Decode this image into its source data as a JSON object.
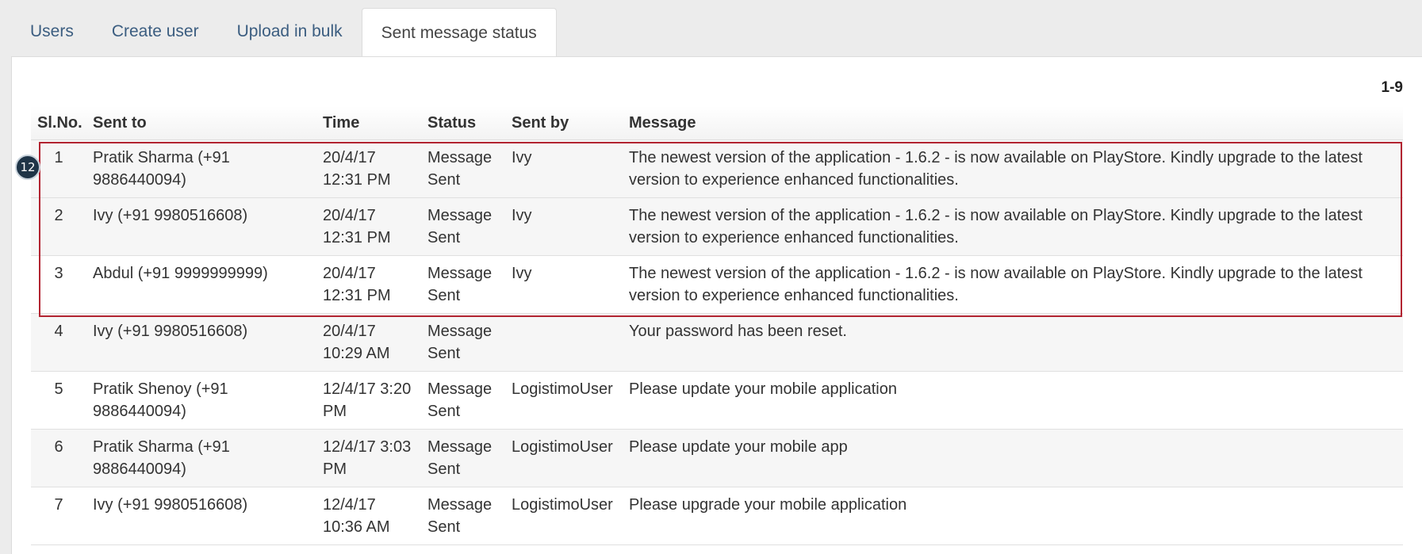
{
  "tabs": [
    {
      "label": "Users"
    },
    {
      "label": "Create user"
    },
    {
      "label": "Upload in bulk"
    },
    {
      "label": "Sent message status",
      "active": true
    }
  ],
  "pagination": {
    "range": "1-9"
  },
  "table": {
    "headers": [
      "Sl.No.",
      "Sent to",
      "Time",
      "Status",
      "Sent by",
      "Message"
    ],
    "rows": [
      [
        "1",
        "Pratik Sharma (+91 9886440094)",
        "20/4/17 12:31 PM",
        "Message Sent",
        "Ivy",
        "The newest version of the application - 1.6.2 - is now available on PlayStore. Kindly upgrade to the latest version to experience enhanced functionalities."
      ],
      [
        "2",
        "Ivy (+91 9980516608)",
        "20/4/17 12:31 PM",
        "Message Sent",
        "Ivy",
        "The newest version of the application - 1.6.2 - is now available on PlayStore. Kindly upgrade to the latest version to experience enhanced functionalities."
      ],
      [
        "3",
        "Abdul (+91 9999999999)",
        "20/4/17 12:31 PM",
        "Message Sent",
        "Ivy",
        "The newest version of the application - 1.6.2 - is now available on PlayStore. Kindly upgrade to the latest version to experience enhanced functionalities."
      ],
      [
        "4",
        "Ivy (+91 9980516608)",
        "20/4/17 10:29 AM",
        "Message Sent",
        "",
        "Your password has been reset."
      ],
      [
        "5",
        "Pratik Shenoy (+91 9886440094)",
        "12/4/17 3:20 PM",
        "Message Sent",
        "LogistimoUser",
        "Please update your mobile application"
      ],
      [
        "6",
        "Pratik Sharma (+91 9886440094)",
        "12/4/17 3:03 PM",
        "Message Sent",
        "LogistimoUser",
        "Please update your mobile app"
      ],
      [
        "7",
        "Ivy (+91 9980516608)",
        "12/4/17 10:36 AM",
        "Message Sent",
        "LogistimoUser",
        "Please upgrade your mobile application"
      ]
    ]
  },
  "annotation": {
    "callout_number": "12",
    "highlight_color": "#b22431"
  }
}
